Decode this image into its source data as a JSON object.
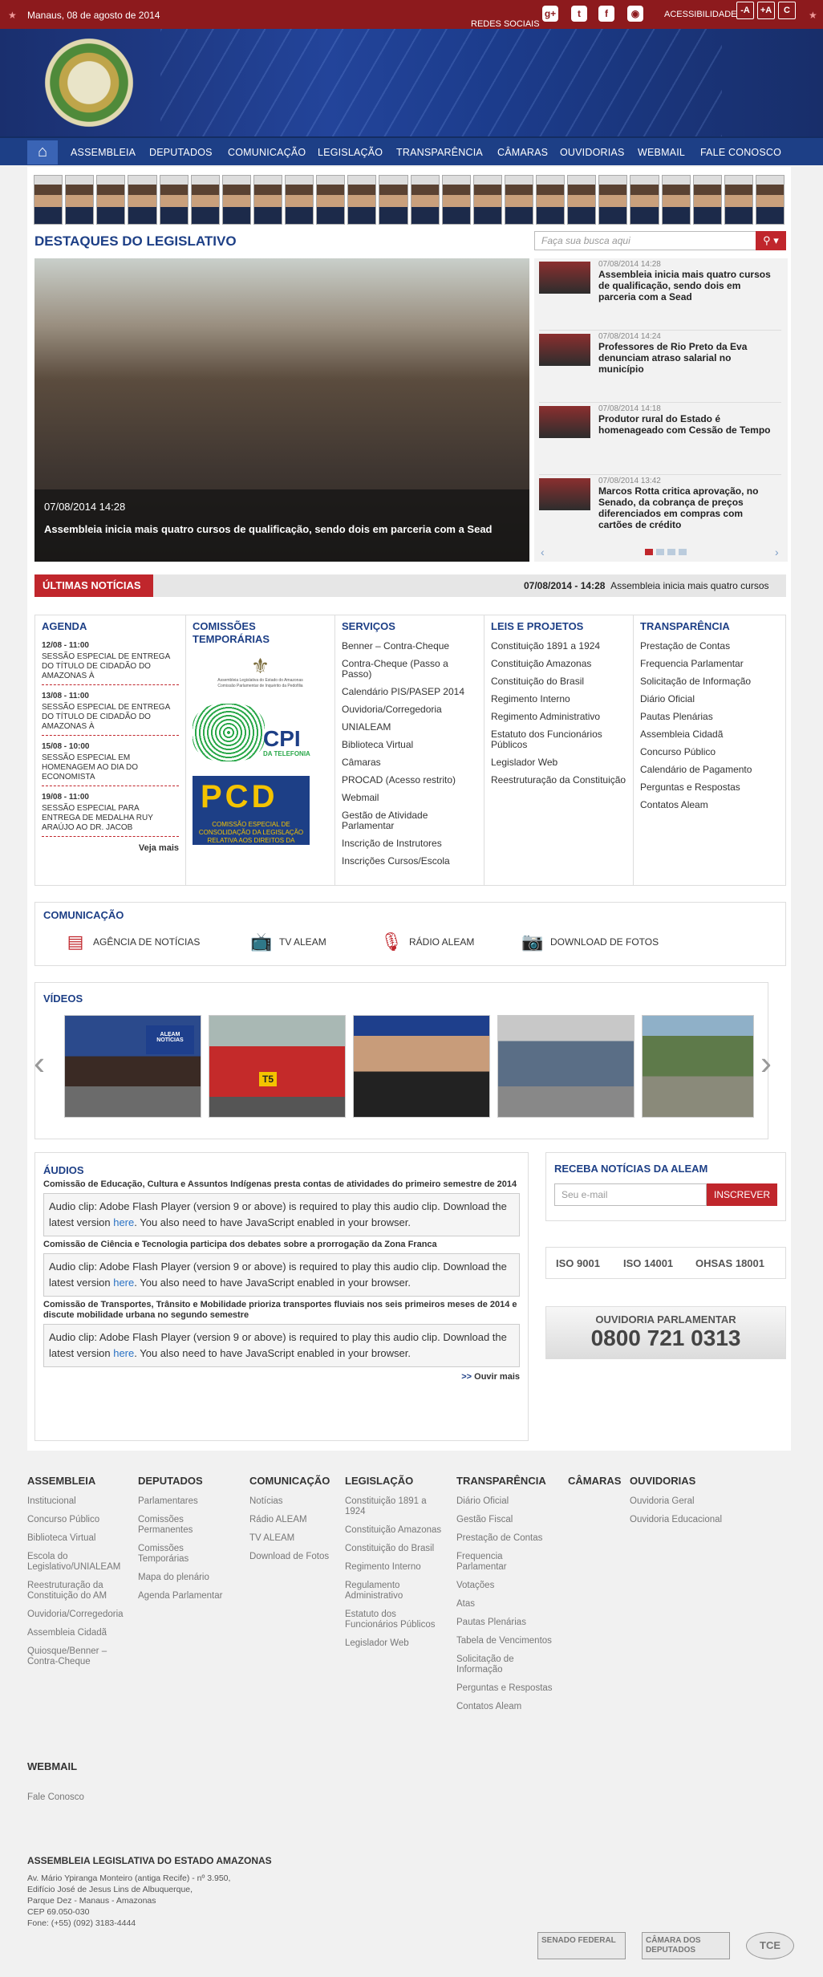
{
  "topbar": {
    "date": "Manaus, 08 de agosto de 2014",
    "redes": "REDES SOCIAIS",
    "acessibilidade": "ACESSIBILIDADE",
    "font_minus": "-A",
    "font_plus": "+A",
    "contrast": "C"
  },
  "nav": {
    "items": [
      "ASSEMBLEIA",
      "DEPUTADOS",
      "COMUNICAÇÃO",
      "LEGISLAÇÃO",
      "TRANSPARÊNCIA",
      "CÂMARAS",
      "OUVIDORIAS",
      "WEBMAIL",
      "FALE CONOSCO"
    ]
  },
  "destaques": {
    "title": "DESTAQUES DO LEGISLATIVO",
    "search_placeholder": "Faça sua busca aqui",
    "slide": {
      "date": "07/08/2014 14:28",
      "headline": "Assembleia inicia mais quatro cursos de qualificação, sendo dois em parceria com a Sead"
    },
    "news": [
      {
        "date": "07/08/2014 14:28",
        "title": "Assembleia inicia mais quatro cursos de qualificação, sendo dois em parceria com a Sead"
      },
      {
        "date": "07/08/2014 14:24",
        "title": "Professores de Rio Preto da Eva denunciam atraso salarial no município"
      },
      {
        "date": "07/08/2014 14:18",
        "title": "Produtor rural do Estado é homenageado com Cessão de Tempo"
      },
      {
        "date": "07/08/2014 13:42",
        "title": "Marcos Rotta critica aprovação, no Senado, da cobrança de preços diferenciados em compras com cartões de crédito"
      }
    ]
  },
  "ultimas": {
    "label": "ÚLTIMAS NOTÍCIAS",
    "ticker_date": "07/08/2014 - 14:28",
    "ticker_text": "Assembleia inicia mais quatro cursos"
  },
  "agenda": {
    "title": "AGENDA",
    "items": [
      {
        "when": "12/08 - 11:00",
        "what": "SESSÃO ESPECIAL DE ENTREGA DO TÍTULO DE CIDADÃO DO AMAZONAS À"
      },
      {
        "when": "13/08 - 11:00",
        "what": "SESSÃO ESPECIAL DE ENTREGA DO TÍTULO DE CIDADÃO DO AMAZONAS À"
      },
      {
        "when": "15/08 - 10:00",
        "what": "SESSÃO ESPECIAL EM HOMENAGEM AO DIA DO ECONOMISTA"
      },
      {
        "when": "19/08 - 11:00",
        "what": "SESSÃO ESPECIAL PARA ENTREGA DE MEDALHA RUY ARAÚJO AO DR. JACOB"
      }
    ],
    "more": "Veja mais"
  },
  "comissoes": {
    "title": "COMISSÕES TEMPORÁRIAS",
    "c1_text": "Assembleia Legislativa do Estado do Amazonas",
    "c1_sub": "Comissão Parlamentar de Inquérito da Pedofilia",
    "cpi": "CPI",
    "cpi_sub": "DA TELEFONIA",
    "pcd": "PCD",
    "pcd_sub": "COMISSÃO ESPECIAL DE CONSOLIDAÇÃO DA LEGISLAÇÃO RELATIVA AOS DIREITOS DA"
  },
  "servicos": {
    "title": "SERVIÇOS",
    "items": [
      "Benner – Contra-Cheque",
      "Contra-Cheque (Passo a Passo)",
      "Calendário PIS/PASEP 2014",
      "Ouvidoria/Corregedoria",
      "UNIALEAM",
      "Biblioteca Virtual",
      "Câmaras",
      "PROCAD (Acesso restrito)",
      "Webmail",
      "Gestão de Atividade Parlamentar",
      "Inscrição de Instrutores",
      "Inscrições Cursos/Escola"
    ]
  },
  "leis": {
    "title": "LEIS E PROJETOS",
    "items": [
      "Constituição 1891 a 1924",
      "Constituição Amazonas",
      "Constituição do Brasil",
      "Regimento Interno",
      "Regimento Administrativo",
      "Estatuto dos Funcionários Públicos",
      "Legislador Web",
      "Reestruturação da Constituição"
    ]
  },
  "transp": {
    "title": "TRANSPARÊNCIA",
    "items": [
      "Prestação de Contas",
      "Frequencia Parlamentar",
      "Solicitação de Informação",
      "Diário Oficial",
      "Pautas Plenárias",
      "Assembleia Cidadã",
      "Concurso Público",
      "Calendário de Pagamento",
      "Perguntas e Respostas",
      "Contatos Aleam"
    ]
  },
  "comunicacao": {
    "title": "COMUNICAÇÃO",
    "items": [
      "AGÊNCIA DE NOTÍCIAS",
      "TV ALEAM",
      "RÁDIO ALEAM",
      "DOWNLOAD DE FOTOS"
    ]
  },
  "videos": {
    "title": "VÍDEOS",
    "tv_label": "ALEAM NOTÍCIAS",
    "bus_label": "T5"
  },
  "audios": {
    "title": "ÁUDIOS",
    "more_prefix": ">>",
    "more": "Ouvir mais",
    "flash_a": "Audio clip: Adobe Flash Player (version 9 or above) is required to play this audio clip. Download the latest version",
    "flash_link": "here",
    "flash_b": ". You also need to have JavaScript enabled in your browser.",
    "items": [
      "Comissão de Educação, Cultura e Assuntos Indígenas presta contas de atividades do primeiro semestre de 2014",
      "Comissão de Ciência e Tecnologia participa dos debates sobre a prorrogação da Zona Franca",
      "Comissão de Transportes, Trânsito e Mobilidade prioriza transportes fluviais nos seis primeiros meses de 2014 e discute mobilidade urbana no segundo semestre"
    ]
  },
  "newsletter": {
    "title": "RECEBA NOTÍCIAS DA ALEAM",
    "placeholder": "Seu e-mail",
    "button": "INSCREVER"
  },
  "iso": [
    "ISO 9001",
    "ISO 14001",
    "OHSAS 18001"
  ],
  "ouvidoria": {
    "label": "OUVIDORIA PARLAMENTAR",
    "phone": "0800 721 0313"
  },
  "footer": {
    "assembleia": {
      "title": "ASSEMBLEIA",
      "items": [
        "Institucional",
        "Concurso Público",
        "Biblioteca Virtual",
        "Escola do Legislativo/UNIALEAM",
        "Reestruturação da Constituição do AM",
        "Ouvidoria/Corregedoria",
        "Assembleia Cidadã",
        "Quiosque/Benner – Contra-Cheque"
      ]
    },
    "deputados": {
      "title": "DEPUTADOS",
      "items": [
        "Parlamentares",
        "Comissões Permanentes",
        "Comissões Temporárias",
        "Mapa do plenário",
        "Agenda Parlamentar"
      ]
    },
    "comunicacao": {
      "title": "COMUNICAÇÃO",
      "items": [
        "Notícias",
        "Rádio ALEAM",
        "TV ALEAM",
        "Download de Fotos"
      ]
    },
    "legislacao": {
      "title": "LEGISLAÇÃO",
      "items": [
        "Constituição 1891 a 1924",
        "Constituição Amazonas",
        "Constituição do Brasil",
        "Regimento Interno",
        "Regulamento Administrativo",
        "Estatuto dos Funcionários Públicos",
        "Legislador Web"
      ]
    },
    "transparencia": {
      "title": "TRANSPARÊNCIA",
      "items": [
        "Diário Oficial",
        "Gestão Fiscal",
        "Prestação de Contas",
        "Frequencia Parlamentar",
        "Votações",
        "Atas",
        "Pautas Plenárias",
        "Tabela de Vencimentos",
        "Solicitação de Informação",
        "Perguntas e Respostas",
        "Contatos Aleam"
      ]
    },
    "camaras": {
      "title": "CÂMARAS"
    },
    "ouvidorias": {
      "title": "OUVIDORIAS",
      "items": [
        "Ouvidoria Geral",
        "Ouvidoria Educacional"
      ]
    },
    "webmail": "WEBMAIL",
    "fale": "Fale Conosco",
    "org": "ASSEMBLEIA LEGISLATIVA DO ESTADO AMAZONAS",
    "address": [
      "Av. Mário Ypiranga Monteiro (antiga Recife) - nº 3.950,",
      "Edifício José de Jesus Lins de Albuquerque,",
      "Parque Dez - Manaus - Amazonas",
      "CEP 69.050-030",
      "Fone: (+55) (092) 3183-4444"
    ],
    "badges": [
      "SENADO FEDERAL",
      "CÂMARA DOS DEPUTADOS",
      "TCE"
    ]
  },
  "colors": {
    "topbar": "#8d1a1d",
    "nav": "#1d3f86",
    "accent": "#c0262c"
  }
}
